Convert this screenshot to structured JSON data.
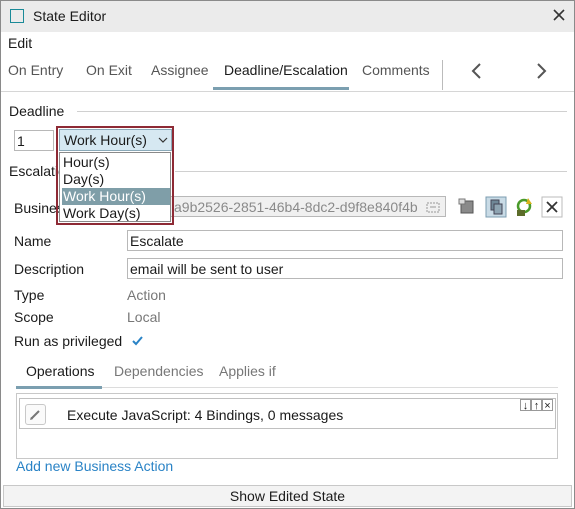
{
  "window": {
    "title": "State Editor",
    "close_icon": "close-icon",
    "app_icon": "window-icon"
  },
  "menu": {
    "edit": "Edit"
  },
  "tabs": [
    {
      "label": "On Entry"
    },
    {
      "label": "On Exit"
    },
    {
      "label": "Assignee"
    },
    {
      "label": "Deadline/Escalation",
      "active": true
    },
    {
      "label": "Comments"
    }
  ],
  "nav": {
    "prev_icon": "chevron-left-icon",
    "next_icon": "chevron-right-icon"
  },
  "deadline": {
    "section_label": "Deadline",
    "amount": "1",
    "unit_selected": "Work Hour(s)",
    "unit_options": [
      "Hour(s)",
      "Day(s)",
      "Work Hour(s)",
      "Work Day(s)"
    ],
    "highlighted_option": "Work Hour(s)"
  },
  "escalation": {
    "section_label": "Escalatio",
    "business_label": "Busines",
    "business_value": "a9b2526-2851-46b4-8dc2-d9f8e840f4b",
    "name_label": "Name",
    "name_value": "Escalate",
    "description_label": "Description",
    "description_value": "email will be sent to user",
    "type_label": "Type",
    "type_value": "Action",
    "scope_label": "Scope",
    "scope_value": "Local",
    "privileged_label": "Run as privileged",
    "privileged_checked": true
  },
  "subtabs": [
    {
      "label": "Operations",
      "active": true
    },
    {
      "label": "Dependencies"
    },
    {
      "label": "Applies if"
    }
  ],
  "operations": [
    {
      "text": "Execute JavaScript: 4 Bindings, 0 messages"
    }
  ],
  "add_action_link": "Add new Business Action",
  "show_state_button": "Show Edited State",
  "colors": {
    "accent": "#1a8a98",
    "link": "#2a83c6",
    "highlight_frame": "#8e2a35",
    "selected_item": "#7f9ea8"
  }
}
